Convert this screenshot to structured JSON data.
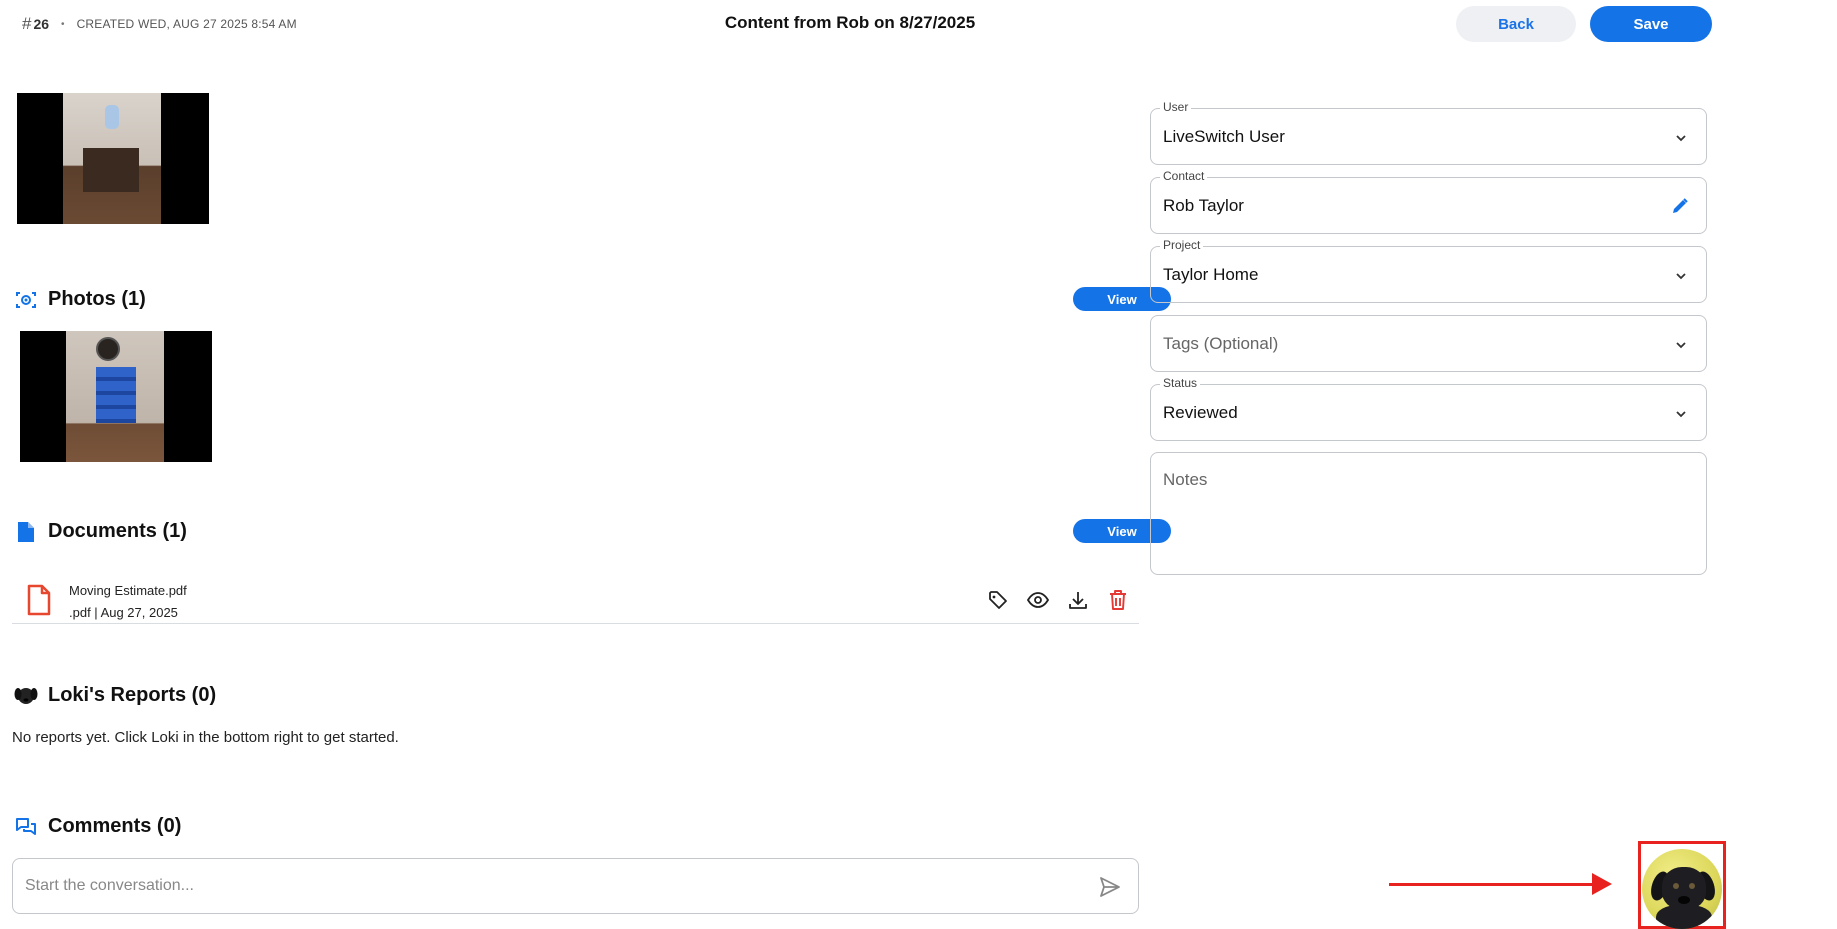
{
  "header": {
    "hash_symbol": "#",
    "record_number": "26",
    "separator": "•",
    "created": "CREATED WED, AUG 27 2025 8:54 AM",
    "title": "Content from Rob on 8/27/2025",
    "back_label": "Back",
    "save_label": "Save"
  },
  "photos": {
    "title": "Photos (1)",
    "view_label": "View",
    "icon": "camera-icon"
  },
  "documents": {
    "title": "Documents (1)",
    "view_label": "View",
    "icon": "document-icon",
    "items": [
      {
        "name": "Moving Estimate.pdf",
        "meta": ".pdf | Aug 27, 2025",
        "actions": [
          "tag-icon",
          "eye-icon",
          "download-icon",
          "trash-icon"
        ]
      }
    ]
  },
  "loki_reports": {
    "title": "Loki's Reports (0)",
    "empty_text": "No reports yet. Click Loki in the bottom right to get started.",
    "icon": "dog-icon"
  },
  "comments": {
    "title": "Comments (0)",
    "placeholder": "Start the conversation...",
    "icon": "chat-bubbles-icon"
  },
  "form": {
    "user": {
      "label": "User",
      "value": "LiveSwitch User"
    },
    "contact": {
      "label": "Contact",
      "value": "Rob Taylor"
    },
    "project": {
      "label": "Project",
      "value": "Taylor Home"
    },
    "tags": {
      "placeholder": "Tags (Optional)"
    },
    "status": {
      "label": "Status",
      "value": "Reviewed"
    },
    "notes": {
      "placeholder": "Notes"
    }
  },
  "colors": {
    "accent": "#1473e6",
    "annotation": "#e8231f",
    "pdf_icon": "#e8472f",
    "delete_icon": "#e53935"
  }
}
